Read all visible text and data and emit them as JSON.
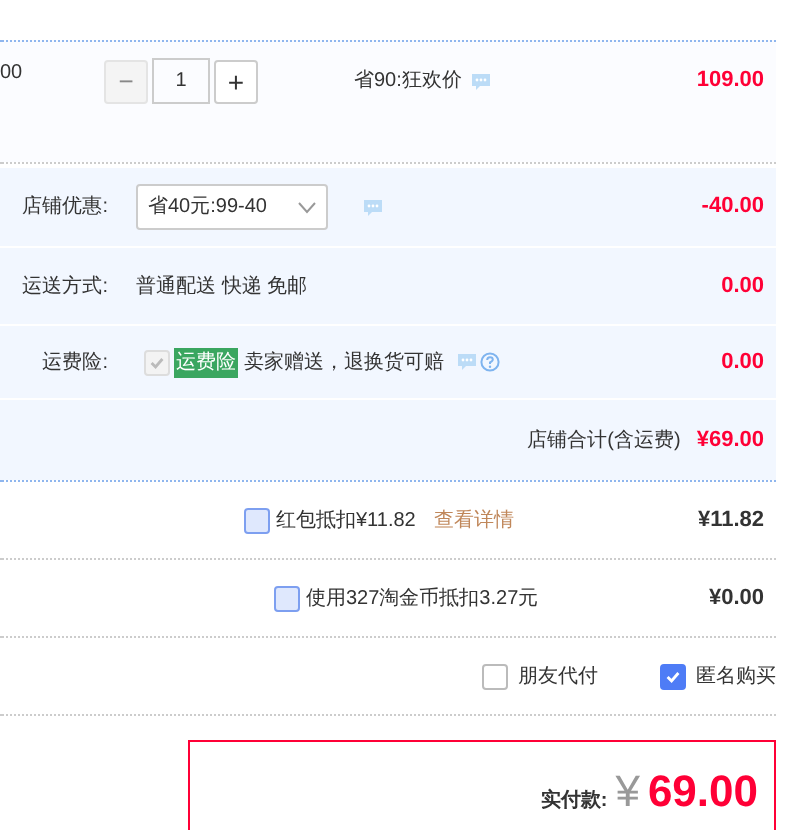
{
  "item": {
    "price_fragment": "00",
    "quantity": "1",
    "minus": "−",
    "plus": "+",
    "promo": "省90:狂欢价",
    "price": "109.00",
    "minus_disabled": true
  },
  "shop_discount": {
    "label": "店铺优惠:",
    "select": "省40元:99-40",
    "amount": "-40.00"
  },
  "shipping": {
    "label": "运送方式:",
    "value": "普通配送 快递 免邮",
    "amount": "0.00"
  },
  "insurance": {
    "label": "运费险:",
    "checked": true,
    "disabled": true,
    "tag": "运费险",
    "text": "卖家赠送，退换货可赔",
    "amount": "0.00"
  },
  "shop_total": {
    "label": "店铺合计(含运费)",
    "amount": "¥69.00"
  },
  "deductions": [
    {
      "checked": false,
      "text": "红包抵扣¥11.82",
      "link": "查看详情",
      "amount": "¥11.82"
    },
    {
      "checked": false,
      "text": "使用327淘金币抵扣3.27元",
      "amount": "¥0.00"
    }
  ],
  "options": [
    {
      "label": "朋友代付",
      "checked": false
    },
    {
      "label": "匿名购买",
      "checked": true
    }
  ],
  "payment": {
    "label": "实付款:",
    "currency": "¥",
    "amount": "69.00"
  }
}
